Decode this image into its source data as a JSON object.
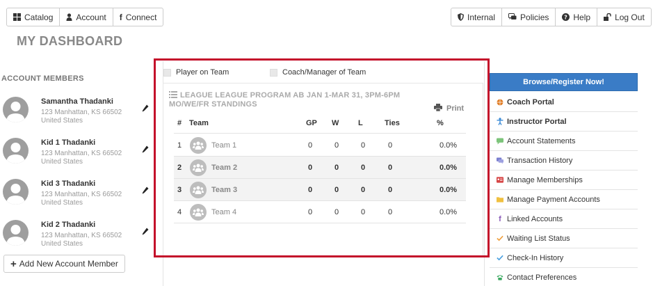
{
  "top_nav_left": [
    {
      "label": "Catalog",
      "icon": "grid-icon"
    },
    {
      "label": "Account",
      "icon": "user-icon"
    },
    {
      "label": "Connect",
      "icon": "facebook-icon"
    }
  ],
  "top_nav_right": [
    {
      "label": "Internal",
      "icon": "shield-icon"
    },
    {
      "label": "Policies",
      "icon": "comments-icon"
    },
    {
      "label": "Help",
      "icon": "question-circle-icon"
    },
    {
      "label": "Log Out",
      "icon": "unlock-icon"
    }
  ],
  "page_title": "MY DASHBOARD",
  "account_members": {
    "heading": "ACCOUNT MEMBERS",
    "members": [
      {
        "name": "Samantha Thadanki",
        "address": "123 Manhattan, KS 66502",
        "country": "United States"
      },
      {
        "name": "Kid 1 Thadanki",
        "address": "123 Manhattan, KS 66502",
        "country": "United States"
      },
      {
        "name": "Kid 3 Thadanki",
        "address": "123 Manhattan, KS 66502",
        "country": "United States"
      },
      {
        "name": "Kid 2 Thadanki",
        "address": "123 Manhattan, KS 66502",
        "country": "United States"
      }
    ],
    "add_button": "Add New Account Member"
  },
  "filters": {
    "player_on_team": "Player on Team",
    "coach_manager": "Coach/Manager of Team"
  },
  "standings": {
    "title": "LEAGUE LEAGUE PROGRAM AB JAN 1-MAR 31, 3PM-6PM MO/WE/FR STANDINGS",
    "print_label": "Print",
    "columns": {
      "rank": "#",
      "team": "Team",
      "gp": "GP",
      "w": "W",
      "l": "L",
      "ties": "Ties",
      "pct": "%"
    },
    "rows": [
      {
        "rank": "1",
        "team": "Team 1",
        "gp": "0",
        "w": "0",
        "l": "0",
        "ties": "0",
        "pct": "0.0%"
      },
      {
        "rank": "2",
        "team": "Team 2",
        "gp": "0",
        "w": "0",
        "l": "0",
        "ties": "0",
        "pct": "0.0%"
      },
      {
        "rank": "3",
        "team": "Team 3",
        "gp": "0",
        "w": "0",
        "l": "0",
        "ties": "0",
        "pct": "0.0%"
      },
      {
        "rank": "4",
        "team": "Team 4",
        "gp": "0",
        "w": "0",
        "l": "0",
        "ties": "0",
        "pct": "0.0%"
      }
    ]
  },
  "sidebar": {
    "register_button": "Browse/Register Now!",
    "links": [
      {
        "label": "Coach Portal",
        "icon": "basketball-icon",
        "color": "#e07b22"
      },
      {
        "label": "Instructor Portal",
        "icon": "person-icon",
        "color": "#3a8ad6"
      },
      {
        "label": "Account Statements",
        "icon": "comment-icon",
        "color": "#7cc47a"
      },
      {
        "label": "Transaction History",
        "icon": "comments-icon",
        "color": "#7b7fcf"
      },
      {
        "label": "Manage Memberships",
        "icon": "id-card-icon",
        "color": "#d64545"
      },
      {
        "label": "Manage Payment Accounts",
        "icon": "folder-icon",
        "color": "#f0c040"
      },
      {
        "label": "Linked Accounts",
        "icon": "facebook-icon",
        "color": "#8a5ab8"
      },
      {
        "label": "Waiting List Status",
        "icon": "check-icon",
        "color": "#f0a040"
      },
      {
        "label": "Check-In History",
        "icon": "check-icon",
        "color": "#4aa0e0"
      },
      {
        "label": "Contact Preferences",
        "icon": "phone-icon",
        "color": "#3aa860"
      }
    ]
  }
}
